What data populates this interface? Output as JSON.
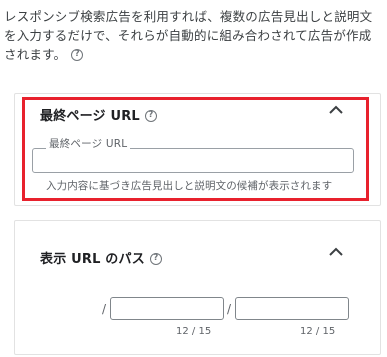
{
  "intro": {
    "text": "レスポンシブ検索広告を利用すれば、複数の広告見出しと説明文を入力するだけで、それらが自動的に組み合わされて広告が作成されます。",
    "help_icon": "?"
  },
  "final_url_section": {
    "title": "最終ページ URL",
    "help_icon": "?",
    "field_label": "最終ページ URL",
    "field_value": "",
    "helper_text": "入力内容に基づき広告見出しと説明文の候補が表示されます"
  },
  "display_path_section": {
    "title": "表示 URL のパス",
    "help_icon": "?",
    "separator1": "/",
    "separator2": "/",
    "path1_value": "",
    "path2_value": "",
    "path1_counter": "12 / 15",
    "path2_counter": "12 / 15"
  },
  "colors": {
    "highlight": "#e8212d",
    "text": "#3c4043"
  },
  "icons": [
    "help-icon",
    "chevron-up-icon"
  ]
}
